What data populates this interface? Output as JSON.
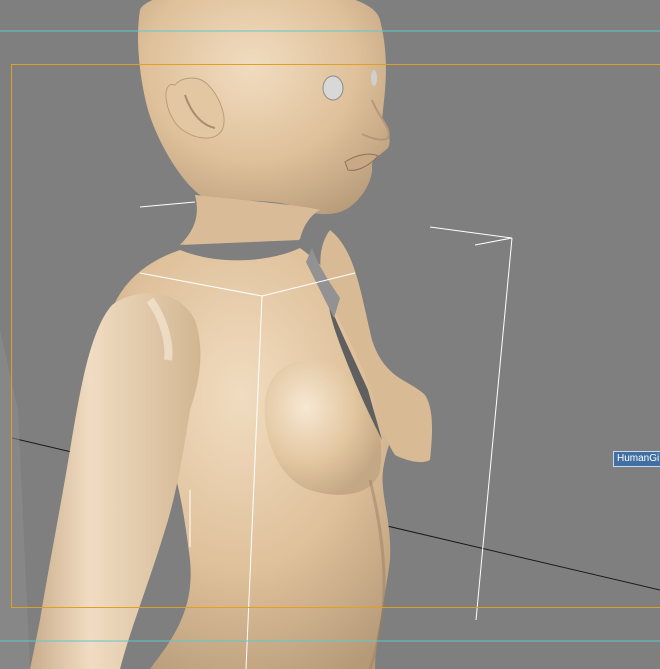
{
  "viewport": {
    "background_color": "#7f7f7f",
    "safe_frame_color": "#e0a020",
    "guide_line_color": "#5ec8d0",
    "bounding_box_color": "#ffffff",
    "skin_color": "#e6caa6"
  },
  "object": {
    "label": "HumanGi"
  }
}
